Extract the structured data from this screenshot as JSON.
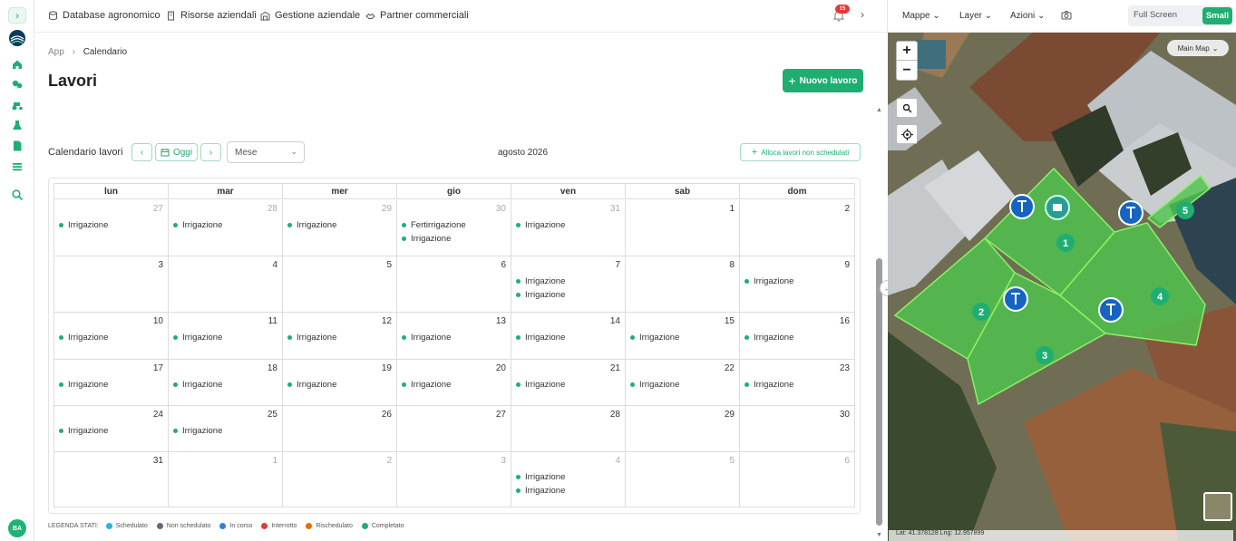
{
  "nav": {
    "items": [
      "Database agronomico",
      "Risorse aziendali",
      "Gestione aziendale",
      "Partner commerciali"
    ],
    "notification_count": "15"
  },
  "user": {
    "initials": "BA"
  },
  "breadcrumb": {
    "root": "App",
    "sep": "›",
    "current": "Calendario"
  },
  "page": {
    "title": "Lavori",
    "new_button": "Nuovo lavoro"
  },
  "calendar": {
    "title": "Calendario lavori",
    "today_label": "Oggi",
    "view": "Mese",
    "month_label": "agosto 2026",
    "alloc_button": "Alloca lavori non schedulati",
    "weekdays": [
      "lun",
      "mar",
      "mer",
      "gio",
      "ven",
      "sab",
      "dom"
    ],
    "weeks": [
      [
        {
          "d": "27",
          "o": true,
          "e": [
            "Irrigazione"
          ]
        },
        {
          "d": "28",
          "o": true,
          "e": [
            "Irrigazione"
          ]
        },
        {
          "d": "29",
          "o": true,
          "e": [
            "Irrigazione"
          ]
        },
        {
          "d": "30",
          "o": true,
          "e": [
            "Fertirrigazione",
            "Irrigazione"
          ]
        },
        {
          "d": "31",
          "o": true,
          "e": [
            "Irrigazione"
          ]
        },
        {
          "d": "1",
          "o": false,
          "e": []
        },
        {
          "d": "2",
          "o": false,
          "e": []
        }
      ],
      [
        {
          "d": "3",
          "o": false,
          "e": []
        },
        {
          "d": "4",
          "o": false,
          "e": []
        },
        {
          "d": "5",
          "o": false,
          "e": []
        },
        {
          "d": "6",
          "o": false,
          "e": []
        },
        {
          "d": "7",
          "o": false,
          "e": [
            "Irrigazione",
            "Irrigazione"
          ]
        },
        {
          "d": "8",
          "o": false,
          "e": []
        },
        {
          "d": "9",
          "o": false,
          "e": [
            "Irrigazione"
          ]
        }
      ],
      [
        {
          "d": "10",
          "o": false,
          "e": [
            "Irrigazione"
          ]
        },
        {
          "d": "11",
          "o": false,
          "e": [
            "Irrigazione"
          ]
        },
        {
          "d": "12",
          "o": false,
          "e": [
            "Irrigazione"
          ]
        },
        {
          "d": "13",
          "o": false,
          "e": [
            "Irrigazione"
          ]
        },
        {
          "d": "14",
          "o": false,
          "e": [
            "Irrigazione"
          ]
        },
        {
          "d": "15",
          "o": false,
          "e": [
            "Irrigazione"
          ]
        },
        {
          "d": "16",
          "o": false,
          "e": [
            "Irrigazione"
          ]
        }
      ],
      [
        {
          "d": "17",
          "o": false,
          "e": [
            "Irrigazione"
          ]
        },
        {
          "d": "18",
          "o": false,
          "e": [
            "Irrigazione"
          ]
        },
        {
          "d": "19",
          "o": false,
          "e": [
            "Irrigazione"
          ]
        },
        {
          "d": "20",
          "o": false,
          "e": [
            "Irrigazione"
          ]
        },
        {
          "d": "21",
          "o": false,
          "e": [
            "Irrigazione"
          ]
        },
        {
          "d": "22",
          "o": false,
          "e": [
            "Irrigazione"
          ]
        },
        {
          "d": "23",
          "o": false,
          "e": [
            "Irrigazione"
          ]
        }
      ],
      [
        {
          "d": "24",
          "o": false,
          "e": [
            "Irrigazione"
          ]
        },
        {
          "d": "25",
          "o": false,
          "e": [
            "Irrigazione"
          ]
        },
        {
          "d": "26",
          "o": false,
          "e": []
        },
        {
          "d": "27",
          "o": false,
          "e": []
        },
        {
          "d": "28",
          "o": false,
          "e": []
        },
        {
          "d": "29",
          "o": false,
          "e": []
        },
        {
          "d": "30",
          "o": false,
          "e": []
        }
      ],
      [
        {
          "d": "31",
          "o": false,
          "e": []
        },
        {
          "d": "1",
          "o": true,
          "e": []
        },
        {
          "d": "2",
          "o": true,
          "e": []
        },
        {
          "d": "3",
          "o": true,
          "e": []
        },
        {
          "d": "4",
          "o": true,
          "e": [
            "Irrigazione",
            "Irrigazione"
          ]
        },
        {
          "d": "5",
          "o": true,
          "e": []
        },
        {
          "d": "6",
          "o": true,
          "e": []
        }
      ]
    ]
  },
  "legend": {
    "title": "LEGENDA STATI:",
    "items": [
      {
        "label": "Schedulato",
        "color": "#29b6d6"
      },
      {
        "label": "Non schedulato",
        "color": "#5f6b7a"
      },
      {
        "label": "In corso",
        "color": "#2f7fe0"
      },
      {
        "label": "Interrotto",
        "color": "#e53935"
      },
      {
        "label": "Rischedulato",
        "color": "#ef6c00"
      },
      {
        "label": "Completato",
        "color": "#1fae72"
      }
    ]
  },
  "map": {
    "menus": [
      "Mappe",
      "Layer",
      "Azioni"
    ],
    "fullscreen_label": "Full Screen",
    "small_label": "Small",
    "layer_label": "Main Map",
    "zoom_in": "+",
    "zoom_out": "−",
    "field_labels": [
      "1",
      "2",
      "3",
      "4",
      "5"
    ],
    "coords": "Lat: 41.378128     Lng: 12.957899"
  },
  "colors": {
    "accent": "#1fae72"
  }
}
